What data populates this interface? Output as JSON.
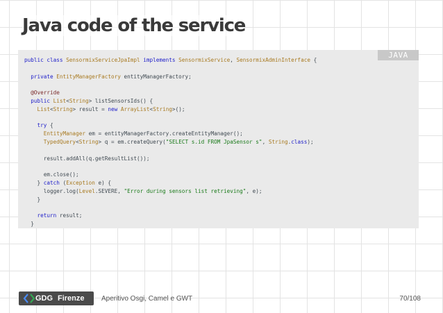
{
  "slide": {
    "title": "Java code of the service",
    "code_language": "JAVA",
    "code_lines": [
      [
        [
          "kw",
          "public class "
        ],
        [
          "ty",
          "SensormixServiceJpaImpl"
        ],
        [
          "kw",
          " implements "
        ],
        [
          "ty",
          "SensormixService"
        ],
        [
          "p",
          ", "
        ],
        [
          "ty",
          "SensormixAdminInterface"
        ],
        [
          "p",
          " {"
        ]
      ],
      [],
      [
        [
          "p",
          "  "
        ],
        [
          "kw",
          "private "
        ],
        [
          "ty",
          "EntityManagerFactory"
        ],
        [
          "p",
          " entityManagerFactory;"
        ]
      ],
      [],
      [
        [
          "p",
          "  "
        ],
        [
          "an",
          "@Override"
        ]
      ],
      [
        [
          "p",
          "  "
        ],
        [
          "kw",
          "public "
        ],
        [
          "ty",
          "List"
        ],
        [
          "p",
          "<"
        ],
        [
          "ty",
          "String"
        ],
        [
          "p",
          "> listSensorsIds() {"
        ]
      ],
      [
        [
          "p",
          "    "
        ],
        [
          "ty",
          "List"
        ],
        [
          "p",
          "<"
        ],
        [
          "ty",
          "String"
        ],
        [
          "p",
          "> result = "
        ],
        [
          "kw",
          "new "
        ],
        [
          "ty",
          "ArrayList"
        ],
        [
          "p",
          "<"
        ],
        [
          "ty",
          "String"
        ],
        [
          "p",
          ">();"
        ]
      ],
      [],
      [
        [
          "p",
          "    "
        ],
        [
          "kw",
          "try"
        ],
        [
          "p",
          " {"
        ]
      ],
      [
        [
          "p",
          "      "
        ],
        [
          "ty",
          "EntityManager"
        ],
        [
          "p",
          " em = entityManagerFactory.createEntityManager();"
        ]
      ],
      [
        [
          "p",
          "      "
        ],
        [
          "ty",
          "TypedQuery"
        ],
        [
          "p",
          "<"
        ],
        [
          "ty",
          "String"
        ],
        [
          "p",
          "> q = em.createQuery("
        ],
        [
          "str",
          "\"SELECT s.id FROM JpaSensor s\""
        ],
        [
          "p",
          ", "
        ],
        [
          "ty",
          "String"
        ],
        [
          "p",
          "."
        ],
        [
          "kw",
          "class"
        ],
        [
          "p",
          ");"
        ]
      ],
      [],
      [
        [
          "p",
          "      result.addAll(q.getResultList());"
        ]
      ],
      [],
      [
        [
          "p",
          "      em.close();"
        ]
      ],
      [
        [
          "p",
          "    } "
        ],
        [
          "kw",
          "catch"
        ],
        [
          "p",
          " ("
        ],
        [
          "ty",
          "Exception"
        ],
        [
          "p",
          " e) {"
        ]
      ],
      [
        [
          "p",
          "      logger.log("
        ],
        [
          "ty",
          "Level"
        ],
        [
          "p",
          ".SEVERE, "
        ],
        [
          "str",
          "\"Error during sensors list retrieving\""
        ],
        [
          "p",
          ", e);"
        ]
      ],
      [
        [
          "p",
          "    }"
        ]
      ],
      [],
      [
        [
          "p",
          "    "
        ],
        [
          "kw",
          "return"
        ],
        [
          "p",
          " result;"
        ]
      ],
      [
        [
          "p",
          "  }"
        ]
      ]
    ]
  },
  "footer": {
    "logo_gdg": "GDG",
    "logo_city": "Firenze",
    "presentation_title": "Aperitivo Osgi, Camel e GWT",
    "page_indicator": "70/108"
  },
  "colors": {
    "keyword": "#1d1dc9",
    "type": "#a87a21",
    "string": "#1a7a1a",
    "annotation": "#7b2b2b",
    "code_background": "#eaeaea"
  }
}
